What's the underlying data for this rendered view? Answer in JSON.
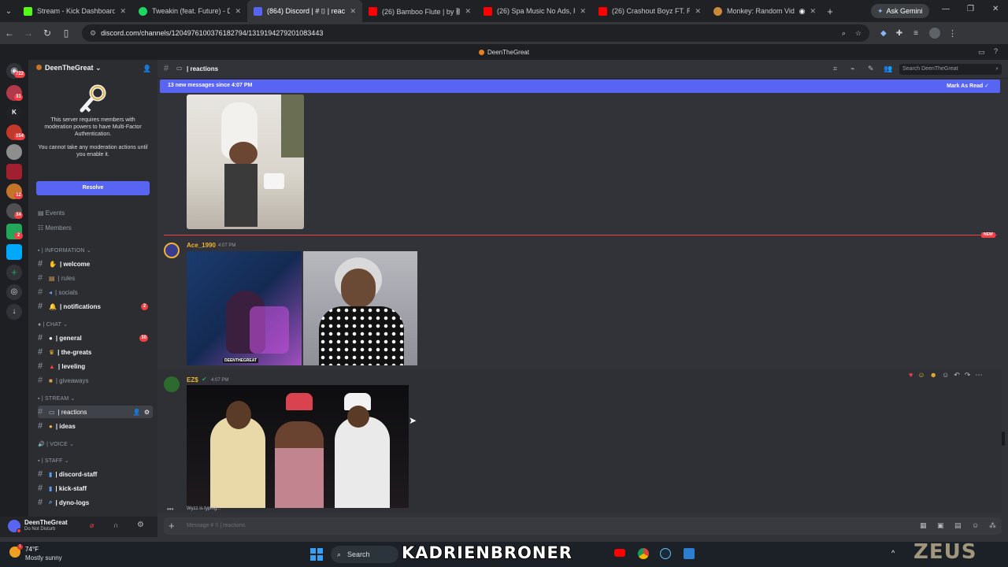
{
  "browser": {
    "tabs": [
      {
        "title": "Stream - Kick Dashboard",
        "color": "#53fc18"
      },
      {
        "title": "Tweakin (feat. Future) - Doe",
        "color": "#1ed760"
      },
      {
        "title": "(864) Discord | # ⌷ | reacti",
        "color": "#5865f2",
        "active": true
      },
      {
        "title": "(26) Bamboo Flute | by 聽も",
        "color": "#ff0000"
      },
      {
        "title": "(26) Spa Music No Ads, Rela",
        "color": "#ff0000"
      },
      {
        "title": "(26) Crashout Boyz FT. Rafly",
        "color": "#ff0000"
      },
      {
        "title": "Monkey: Random Video",
        "color": "#c98a3a"
      }
    ],
    "ask_gemini": "Ask Gemini",
    "url": "discord.com/channels/1204976100376182794/1319194279201083443"
  },
  "app": {
    "top_title": "DeenTheGreat"
  },
  "servers": {
    "badges": [
      "722",
      "31",
      "154",
      "12",
      "34",
      "2"
    ]
  },
  "sidebar": {
    "server_name": "DeenTheGreat",
    "mfa_text": "This server requires members with moderation powers to have Multi-Factor Authentication.",
    "mfa_text2": "You cannot take any moderation actions until you enable it.",
    "resolve_label": "Resolve",
    "events": "Events",
    "members": "Members",
    "categories": {
      "information": "| INFORMATION",
      "chat": "| CHAT",
      "stream": "| STREAM",
      "voice": "| VOICE",
      "staff": "| STAFF"
    },
    "channels": {
      "welcome": "| welcome",
      "rules": "| rules",
      "socials": "| socials",
      "notifications": "| notifications",
      "notifications_badge": "2",
      "general": "| general",
      "general_badge": "10",
      "the_greats": "| the-greats",
      "leveling": "| leveling",
      "giveaways": "| giveaways",
      "reactions": "| reactions",
      "ideas": "| ideas",
      "discord_staff": "| discord-staff",
      "kick_staff": "| kick-staff",
      "dyno_logs": "| dyno-logs"
    }
  },
  "user": {
    "name": "DeenTheGreat",
    "status": "Do Not Disturb"
  },
  "channel": {
    "name": "| reactions",
    "search_placeholder": "Search DeenTheGreat",
    "new_messages": "13 new messages since 4:07 PM",
    "mark_read": "Mark As Read",
    "new_label": "NEW"
  },
  "messages": [
    {
      "author": "Ace_1990",
      "time": "4:07 PM",
      "color": "#f0b232"
    },
    {
      "author": "EZ$",
      "time": "4:07 PM",
      "color": "#f0b232"
    }
  ],
  "composer": {
    "placeholder": "Message # ⌷ | reactions",
    "typing": "Wyzz is typing..."
  },
  "taskbar": {
    "weather_temp": "74°F",
    "weather_desc": "Mostly sunny",
    "search": "Search",
    "overlay_text": "KADRIENBRONER",
    "watermark": "ZEUS"
  },
  "image_caption": "DEENTHEGREAT"
}
